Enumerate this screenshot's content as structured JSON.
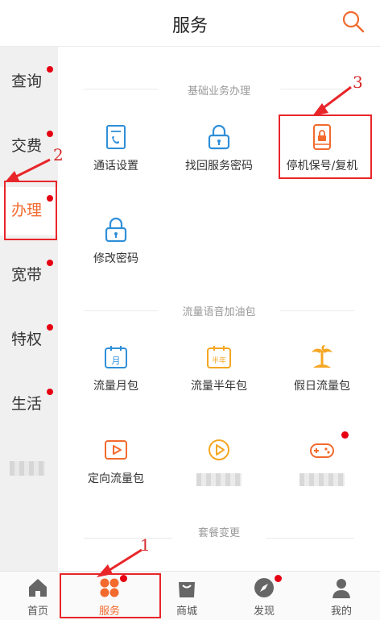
{
  "header": {
    "title": "服务",
    "search_icon": "search-icon"
  },
  "sidebar": {
    "items": [
      {
        "label": "查询",
        "dot": true
      },
      {
        "label": "交费",
        "dot": true
      },
      {
        "label": "办理",
        "dot": true,
        "active": true
      },
      {
        "label": "宽带",
        "dot": true
      },
      {
        "label": "特权",
        "dot": true
      },
      {
        "label": "生活",
        "dot": true
      },
      {
        "label": "",
        "blurred": true
      }
    ]
  },
  "sections": [
    {
      "title": "基础业务办理",
      "items": [
        {
          "label": "通话设置",
          "icon": "phone-settings-icon"
        },
        {
          "label": "找回服务密码",
          "icon": "lock-icon"
        },
        {
          "label": "停机保号/复机",
          "icon": "phone-lock-icon"
        },
        {
          "label": "修改密码",
          "icon": "lock-icon"
        }
      ]
    },
    {
      "title": "流量语音加油包",
      "items": [
        {
          "label": "流量月包",
          "icon": "calendar-month-icon",
          "icon_text": "月"
        },
        {
          "label": "流量半年包",
          "icon": "calendar-half-year-icon",
          "icon_text": "半年"
        },
        {
          "label": "假日流量包",
          "icon": "palm-tree-icon"
        },
        {
          "label": "定向流量包",
          "icon": "play-icon"
        },
        {
          "label": "",
          "icon": "video-icon",
          "blurred": true
        },
        {
          "label": "",
          "icon": "gamepad-icon",
          "blurred": true,
          "dot": true
        }
      ]
    },
    {
      "title": "套餐变更"
    }
  ],
  "tabbar": {
    "tabs": [
      {
        "label": "首页",
        "icon": "home-icon"
      },
      {
        "label": "服务",
        "icon": "services-icon",
        "active": true,
        "dot": true
      },
      {
        "label": "商城",
        "icon": "shopping-bag-icon"
      },
      {
        "label": "发现",
        "icon": "compass-icon",
        "dot": true
      },
      {
        "label": "我的",
        "icon": "user-icon"
      }
    ]
  },
  "annotations": {
    "labels": [
      "1",
      "2",
      "3"
    ],
    "color": "#e8262a"
  },
  "colors": {
    "accent": "#f26a2e",
    "icon_blue": "#2f8fd8",
    "icon_orange": "#f5a623",
    "badge": "#e60012"
  }
}
